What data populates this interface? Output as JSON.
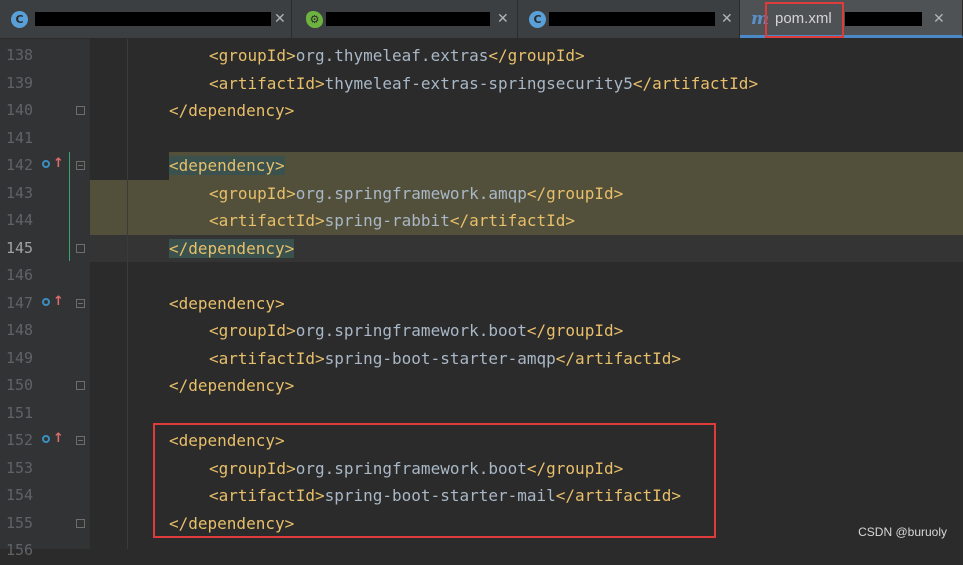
{
  "tabs": [
    {
      "icon": "C",
      "title_redacted": true
    },
    {
      "icon": "spring-boot",
      "title_redacted": true
    },
    {
      "icon": "C",
      "title_redacted": true
    },
    {
      "icon": "m",
      "label": "pom.xml",
      "title_redacted": true,
      "active": true
    }
  ],
  "lines": [
    {
      "num": "138",
      "indent": 2,
      "parts": [
        [
          "tag",
          "<groupId>"
        ],
        [
          "txt",
          "org.thymeleaf.extras"
        ],
        [
          "tag",
          "</groupId>"
        ]
      ]
    },
    {
      "num": "139",
      "indent": 2,
      "parts": [
        [
          "tag",
          "<artifactId>"
        ],
        [
          "txt",
          "thymeleaf-extras-springsecurity5"
        ],
        [
          "tag",
          "</artifactId>"
        ]
      ]
    },
    {
      "num": "140",
      "indent": 1,
      "parts": [
        [
          "tag",
          "</dependency>"
        ]
      ]
    },
    {
      "num": "141",
      "indent": 0,
      "parts": []
    },
    {
      "num": "142",
      "indent": 1,
      "parts": [
        [
          "tag",
          "<dependency>"
        ]
      ]
    },
    {
      "num": "143",
      "indent": 2,
      "parts": [
        [
          "tag",
          "<groupId>"
        ],
        [
          "txt",
          "org.springframework.amqp"
        ],
        [
          "tag",
          "</groupId>"
        ]
      ]
    },
    {
      "num": "144",
      "indent": 2,
      "parts": [
        [
          "tag",
          "<artifactId>"
        ],
        [
          "txt",
          "spring-rabbit"
        ],
        [
          "tag",
          "</artifactId>"
        ]
      ]
    },
    {
      "num": "145",
      "indent": 1,
      "parts": [
        [
          "tag",
          "</dependency>"
        ]
      ]
    },
    {
      "num": "146",
      "indent": 0,
      "parts": []
    },
    {
      "num": "147",
      "indent": 1,
      "parts": [
        [
          "tag",
          "<dependency>"
        ]
      ]
    },
    {
      "num": "148",
      "indent": 2,
      "parts": [
        [
          "tag",
          "<groupId>"
        ],
        [
          "txt",
          "org.springframework.boot"
        ],
        [
          "tag",
          "</groupId>"
        ]
      ]
    },
    {
      "num": "149",
      "indent": 2,
      "parts": [
        [
          "tag",
          "<artifactId>"
        ],
        [
          "txt",
          "spring-boot-starter-amqp"
        ],
        [
          "tag",
          "</artifactId>"
        ]
      ]
    },
    {
      "num": "150",
      "indent": 1,
      "parts": [
        [
          "tag",
          "</dependency>"
        ]
      ]
    },
    {
      "num": "151",
      "indent": 0,
      "parts": []
    },
    {
      "num": "152",
      "indent": 1,
      "parts": [
        [
          "tag",
          "<dependency>"
        ]
      ]
    },
    {
      "num": "153",
      "indent": 2,
      "parts": [
        [
          "tag",
          "<groupId>"
        ],
        [
          "txt",
          "org.springframework.boot"
        ],
        [
          "tag",
          "</groupId>"
        ]
      ]
    },
    {
      "num": "154",
      "indent": 2,
      "parts": [
        [
          "tag",
          "<artifactId>"
        ],
        [
          "txt",
          "spring-boot-starter-mail"
        ],
        [
          "tag",
          "</artifactId>"
        ]
      ]
    },
    {
      "num": "155",
      "indent": 1,
      "parts": [
        [
          "tag",
          "</dependency>"
        ]
      ]
    },
    {
      "num": "156",
      "indent": 0,
      "parts": []
    }
  ],
  "current_line": "145",
  "gutter_markers": {
    "142": "implement-up-icon",
    "147": "implement-up-icon",
    "152": "implement-up-icon"
  },
  "fold_markers": {
    "140": "fold-end",
    "142": "fold-start",
    "145": "fold-end",
    "147": "fold-start",
    "150": "fold-end",
    "152": "fold-start",
    "155": "fold-end"
  },
  "highlighted_lines": [
    "142",
    "143",
    "144",
    "145"
  ],
  "annotations": {
    "boxed_tab": "pom.xml",
    "boxed_lines": [
      "152",
      "155"
    ],
    "box_color": "#e03b3b"
  },
  "watermark": "CSDN @buruoly",
  "colors": {
    "tag": "#e8bf6a",
    "text": "#a9b7c6",
    "highlight": "#52503a",
    "line_number": "#606366"
  }
}
